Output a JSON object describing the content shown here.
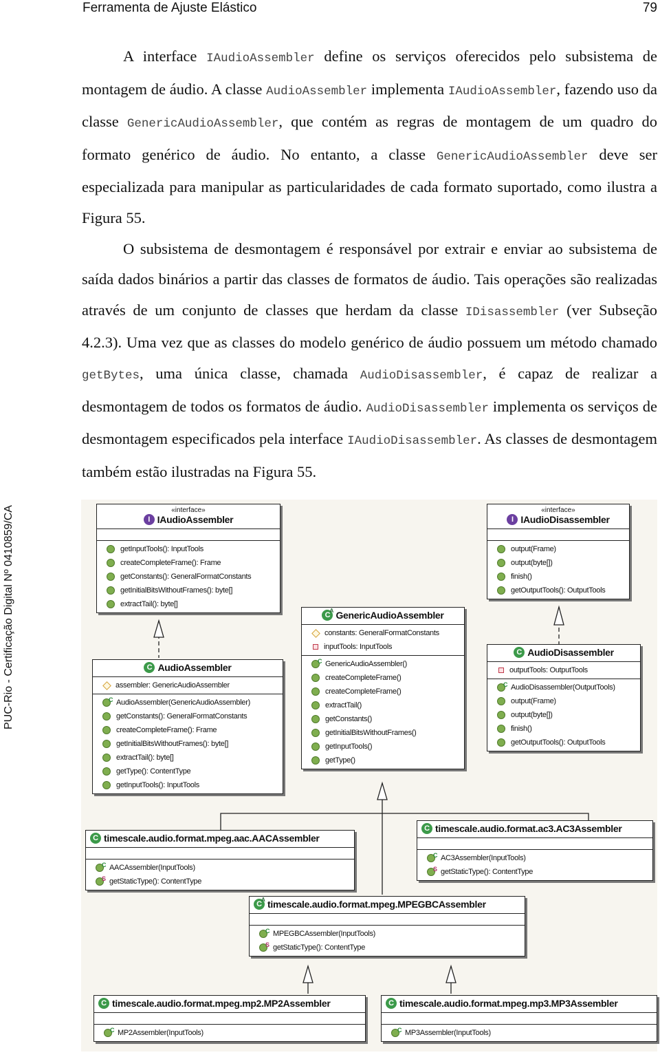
{
  "header": {
    "title": "Ferramenta de Ajuste Elástico",
    "page_number": "79"
  },
  "side_note": "PUC-Rio - Certificação Digital Nº 0410859/CA",
  "paragraphs": [
    {
      "parts": [
        {
          "t": "A interface "
        },
        {
          "c": "IAudioAssembler"
        },
        {
          "t": " define os serviços oferecidos pelo subsistema de montagem de áudio. A classe "
        },
        {
          "c": "AudioAssembler"
        },
        {
          "t": " implementa "
        },
        {
          "c": "IAudioAssembler"
        },
        {
          "t": ", fazendo uso da classe "
        },
        {
          "c": "GenericAudioAssembler"
        },
        {
          "t": ", que contém as regras de montagem de um quadro do formato genérico de áudio. No entanto, a classe "
        },
        {
          "c": "GenericAudioAssembler"
        },
        {
          "t": " deve ser especializada para manipular as particularidades de cada formato suportado, como ilustra a Figura 55."
        }
      ]
    },
    {
      "parts": [
        {
          "t": "O subsistema de desmontagem é responsável por extrair e enviar ao subsistema de saída dados binários a partir das classes de formatos de áudio. Tais operações são realizadas através de um conjunto de classes que herdam da classe "
        },
        {
          "c": "IDisassembler"
        },
        {
          "t": " (ver Subseção 4.2.3). Uma vez que as classes do modelo genérico de áudio possuem um método chamado "
        },
        {
          "c": "getBytes"
        },
        {
          "t": ", uma única classe, chamada "
        },
        {
          "c": "AudioDisassembler"
        },
        {
          "t": ", é capaz de realizar a desmontagem de todos os formatos de áudio. "
        },
        {
          "c": "AudioDisassembler"
        },
        {
          "t": " implementa os serviços de desmontagem especificados pela interface "
        },
        {
          "c": "IAudioDisassembler"
        },
        {
          "t": ". As classes de desmontagem também estão ilustradas na Figura 55."
        }
      ]
    }
  ],
  "diagram": {
    "stereotype": "«interface»",
    "classes": {
      "iaudioassembler": {
        "name": "IAudioAssembler",
        "kind": "interface",
        "attributes": [],
        "methods": [
          {
            "icon": "method",
            "text": "getInputTools(): InputTools"
          },
          {
            "icon": "method",
            "text": "createCompleteFrame(): Frame"
          },
          {
            "icon": "method",
            "text": "getConstants(): GeneralFormatConstants"
          },
          {
            "icon": "method",
            "text": "getInitialBitsWithoutFrames(): byte[]"
          },
          {
            "icon": "method",
            "text": "extractTail(): byte[]"
          }
        ]
      },
      "iaudiodisassembler": {
        "name": "IAudioDisassembler",
        "kind": "interface",
        "attributes": [],
        "methods": [
          {
            "icon": "method",
            "text": "output(Frame)"
          },
          {
            "icon": "method",
            "text": "output(byte[])"
          },
          {
            "icon": "method",
            "text": "finish()"
          },
          {
            "icon": "method",
            "text": "getOutputTools(): OutputTools"
          }
        ]
      },
      "genericaudioassembler": {
        "name": "GenericAudioAssembler",
        "kind": "abstract",
        "attributes": [
          {
            "icon": "protected",
            "text": "constants: GeneralFormatConstants"
          },
          {
            "icon": "private",
            "text": "inputTools: InputTools"
          }
        ],
        "methods": [
          {
            "icon": "ctor",
            "text": "GenericAudioAssembler()"
          },
          {
            "icon": "method",
            "text": "createCompleteFrame()"
          },
          {
            "icon": "method",
            "text": "createCompleteFrame()"
          },
          {
            "icon": "method",
            "text": "extractTail()"
          },
          {
            "icon": "method",
            "text": "getConstants()"
          },
          {
            "icon": "method",
            "text": "getInitialBitsWithoutFrames()"
          },
          {
            "icon": "method",
            "text": "getInputTools()"
          },
          {
            "icon": "method",
            "text": "getType()"
          }
        ]
      },
      "audioassembler": {
        "name": "AudioAssembler",
        "kind": "class",
        "attributes": [
          {
            "icon": "protected",
            "text": "assembler: GenericAudioAssembler"
          }
        ],
        "methods": [
          {
            "icon": "ctor",
            "text": "AudioAssembler(GenericAudioAssembler)"
          },
          {
            "icon": "method",
            "text": "getConstants(): GeneralFormatConstants"
          },
          {
            "icon": "method",
            "text": "createCompleteFrame(): Frame"
          },
          {
            "icon": "method",
            "text": "getInitialBitsWithoutFrames(): byte[]"
          },
          {
            "icon": "method",
            "text": "extractTail(): byte[]"
          },
          {
            "icon": "method",
            "text": "getType(): ContentType"
          },
          {
            "icon": "method",
            "text": "getInputTools(): InputTools"
          }
        ]
      },
      "audiodisassembler": {
        "name": "AudioDisassembler",
        "kind": "class",
        "attributes": [
          {
            "icon": "private",
            "text": "outputTools: OutputTools"
          }
        ],
        "methods": [
          {
            "icon": "ctor",
            "text": "AudioDisassembler(OutputTools)"
          },
          {
            "icon": "method",
            "text": "output(Frame)"
          },
          {
            "icon": "method",
            "text": "output(byte[])"
          },
          {
            "icon": "method",
            "text": "finish()"
          },
          {
            "icon": "method",
            "text": "getOutputTools(): OutputTools"
          }
        ]
      },
      "aacassembler": {
        "name": "timescale.audio.format.mpeg.aac.AACAssembler",
        "kind": "class",
        "attributes": [],
        "methods": [
          {
            "icon": "ctor",
            "text": "AACAssembler(InputTools)"
          },
          {
            "icon": "static",
            "text": "getStaticType(): ContentType"
          }
        ]
      },
      "ac3assembler": {
        "name": "timescale.audio.format.ac3.AC3Assembler",
        "kind": "class",
        "attributes": [],
        "methods": [
          {
            "icon": "ctor",
            "text": "AC3Assembler(InputTools)"
          },
          {
            "icon": "static",
            "text": "getStaticType(): ContentType"
          }
        ]
      },
      "mpegbcassembler": {
        "name": "timescale.audio.format.mpeg.MPEGBCAssembler",
        "kind": "abstract",
        "attributes": [],
        "methods": [
          {
            "icon": "ctor",
            "text": "MPEGBCAssembler(InputTools)"
          },
          {
            "icon": "static",
            "text": "getStaticType(): ContentType"
          }
        ]
      },
      "mp2assembler": {
        "name": "timescale.audio.format.mpeg.mp2.MP2Assembler",
        "kind": "class",
        "attributes": [],
        "methods": [
          {
            "icon": "ctor",
            "text": "MP2Assembler(InputTools)"
          }
        ]
      },
      "mp3assembler": {
        "name": "timescale.audio.format.mpeg.mp3.MP3Assembler",
        "kind": "class",
        "attributes": [],
        "methods": [
          {
            "icon": "ctor",
            "text": "MP3Assembler(InputTools)"
          }
        ]
      }
    },
    "colors": {
      "interface_badge": "#6b3fa0",
      "class_badge": "#3c9a4a",
      "method_dot": "#7fae4f",
      "background": "#f7f5ef"
    }
  }
}
